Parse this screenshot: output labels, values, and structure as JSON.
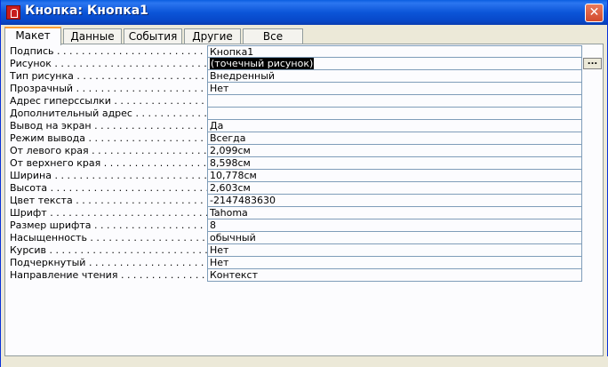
{
  "window": {
    "title": "Кнопка: Кнопка1",
    "close_glyph": "✕"
  },
  "tabs": [
    {
      "label": "Макет",
      "active": true
    },
    {
      "label": "Данные",
      "active": false
    },
    {
      "label": "События",
      "active": false
    },
    {
      "label": "Другие",
      "active": false
    },
    {
      "label": "Все",
      "active": false
    }
  ],
  "properties": [
    {
      "label": "Подпись",
      "value": "Кнопка1"
    },
    {
      "label": "Рисунок",
      "value": "(точечный рисунок)",
      "selected": true
    },
    {
      "label": "Тип рисунка",
      "value": "Внедренный"
    },
    {
      "label": "Прозрачный",
      "value": "Нет"
    },
    {
      "label": "Адрес гиперссылки",
      "value": ""
    },
    {
      "label": "Дополнительный адрес",
      "value": ""
    },
    {
      "label": "Вывод на экран",
      "value": "Да"
    },
    {
      "label": "Режим вывода",
      "value": "Всегда"
    },
    {
      "label": "От левого края",
      "value": "2,099см"
    },
    {
      "label": "От верхнего края",
      "value": "8,598см"
    },
    {
      "label": "Ширина",
      "value": "10,778см"
    },
    {
      "label": "Высота",
      "value": "2,603см"
    },
    {
      "label": "Цвет текста",
      "value": "-2147483630"
    },
    {
      "label": "Шрифт",
      "value": "Tahoma"
    },
    {
      "label": "Размер шрифта",
      "value": "8"
    },
    {
      "label": "Насыщенность",
      "value": "обычный"
    },
    {
      "label": "Курсив",
      "value": "Нет"
    },
    {
      "label": "Подчеркнутый",
      "value": "Нет"
    },
    {
      "label": "Направление чтения",
      "value": "Контекст"
    }
  ],
  "build_button": {
    "label": "..."
  },
  "colors": {
    "title_bar": "#0b55d8",
    "selection": "#000000",
    "tab_highlight": "#ff9f33"
  }
}
